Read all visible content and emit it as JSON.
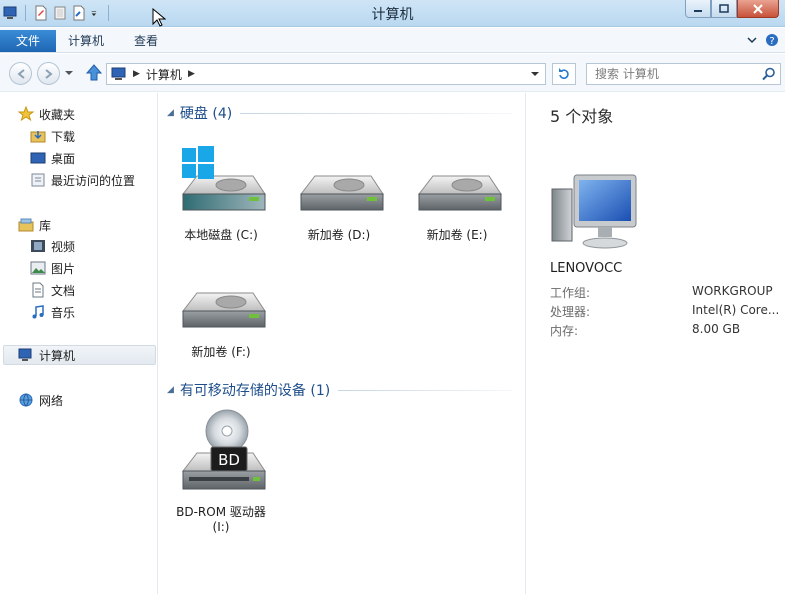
{
  "window": {
    "title": "计算机"
  },
  "ribbon": {
    "tabs": [
      "文件",
      "计算机",
      "查看"
    ]
  },
  "address": {
    "crumb": "计算机"
  },
  "search": {
    "placeholder": "搜索 计算机"
  },
  "nav": {
    "favorites": "收藏夹",
    "favorites_items": [
      "下载",
      "桌面",
      "最近访问的位置"
    ],
    "libraries": "库",
    "library_items": [
      "视频",
      "图片",
      "文档",
      "音乐"
    ],
    "computer": "计算机",
    "network": "网络"
  },
  "groups": {
    "hard_disks": "硬盘 (4)",
    "removable": "有可移动存储的设备 (1)"
  },
  "drives": [
    {
      "label": "本地磁盘 (C:)",
      "icon": "system-drive-icon"
    },
    {
      "label": "新加卷 (D:)",
      "icon": "hard-drive-icon"
    },
    {
      "label": "新加卷 (E:)",
      "icon": "hard-drive-icon"
    },
    {
      "label": "新加卷 (F:)",
      "icon": "hard-drive-icon"
    }
  ],
  "removable": [
    {
      "label": "BD-ROM 驱动器",
      "sub": "(I:)",
      "badge": "BD",
      "icon": "bd-rom-drive-icon"
    }
  ],
  "details": {
    "count": "5 个对象",
    "pc_name": "LENOVOCC",
    "props": [
      {
        "label": "工作组:",
        "value": "WORKGROUP"
      },
      {
        "label": "处理器:",
        "value": "Intel(R) Core..."
      },
      {
        "label": "内存:",
        "value": "8.00 GB"
      }
    ]
  },
  "colors": {
    "accent": "#1e66b4",
    "group_header": "#1e4e8c",
    "titlebar": "#c3def3"
  }
}
